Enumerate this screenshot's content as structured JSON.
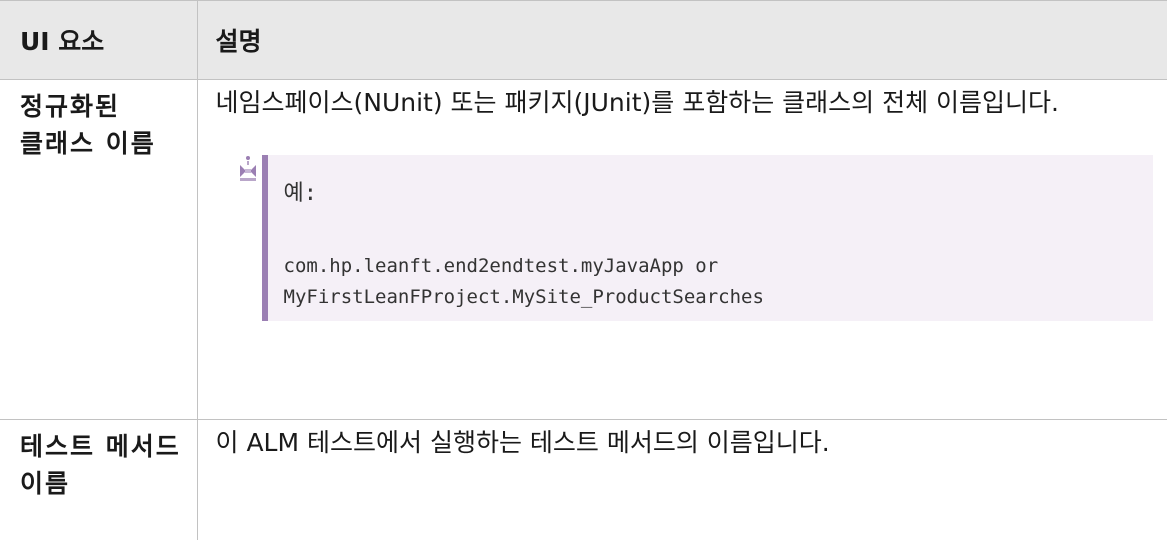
{
  "table": {
    "header": {
      "col1": "UI 요소",
      "col2": "설명"
    },
    "rows": [
      {
        "name": "정규화된 클래스 이름",
        "description": "네임스페이스(NUnit) 또는 패키지(JUnit)를 포함하는 클래스의 전체 이름입니다.",
        "note": {
          "icon": "example-icon",
          "title": "예:",
          "code_line1": "com.hp.leanft.end2endtest.myJavaApp or",
          "code_line2": "MyFirstLeanFProject.MySite_ProductSearches"
        }
      },
      {
        "name": "테스트 메서드 이름",
        "description": "이 ALM 테스트에서 실행하는 테스트 메서드의 이름입니다."
      }
    ]
  },
  "colors": {
    "header_bg": "#e8e8e8",
    "note_bg": "#f5f0f7",
    "note_accent": "#9b7fb3",
    "border": "#c2c2c2"
  }
}
